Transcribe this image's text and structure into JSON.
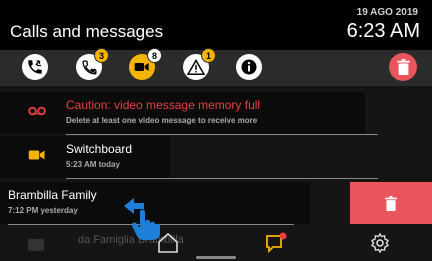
{
  "header": {
    "title": "Calls and messages",
    "date": "19 AGO 2019",
    "time": "6:23 AM"
  },
  "filters": [
    {
      "name": "all-calls-filter",
      "icon": "phone-arrows-icon",
      "badge": ""
    },
    {
      "name": "missed-calls-filter",
      "icon": "missed-call-icon",
      "badge": "3"
    },
    {
      "name": "video-messages-filter",
      "icon": "video-camera-icon",
      "badge": "8"
    },
    {
      "name": "alerts-filter",
      "icon": "warning-icon",
      "badge": "1"
    },
    {
      "name": "info-filter",
      "icon": "info-icon",
      "badge": ""
    }
  ],
  "list": {
    "items": [
      {
        "title": "Caution: video message memory full",
        "subtitle": "Delete at least one video message to receive more",
        "icon": "voicemail-icon"
      },
      {
        "title": "Switchboard",
        "subtitle": "5:23 AM today",
        "icon": "video-camera-icon"
      },
      {
        "title": "Brambilla Family",
        "subtitle": "7:12 PM yesterday",
        "icon": "video-camera-icon"
      }
    ],
    "ghost_title": "da Famiglia Brambilla"
  },
  "colors": {
    "accent_yellow": "#f4b400",
    "alert_red": "#e84040",
    "delete_red": "#e8555a"
  }
}
